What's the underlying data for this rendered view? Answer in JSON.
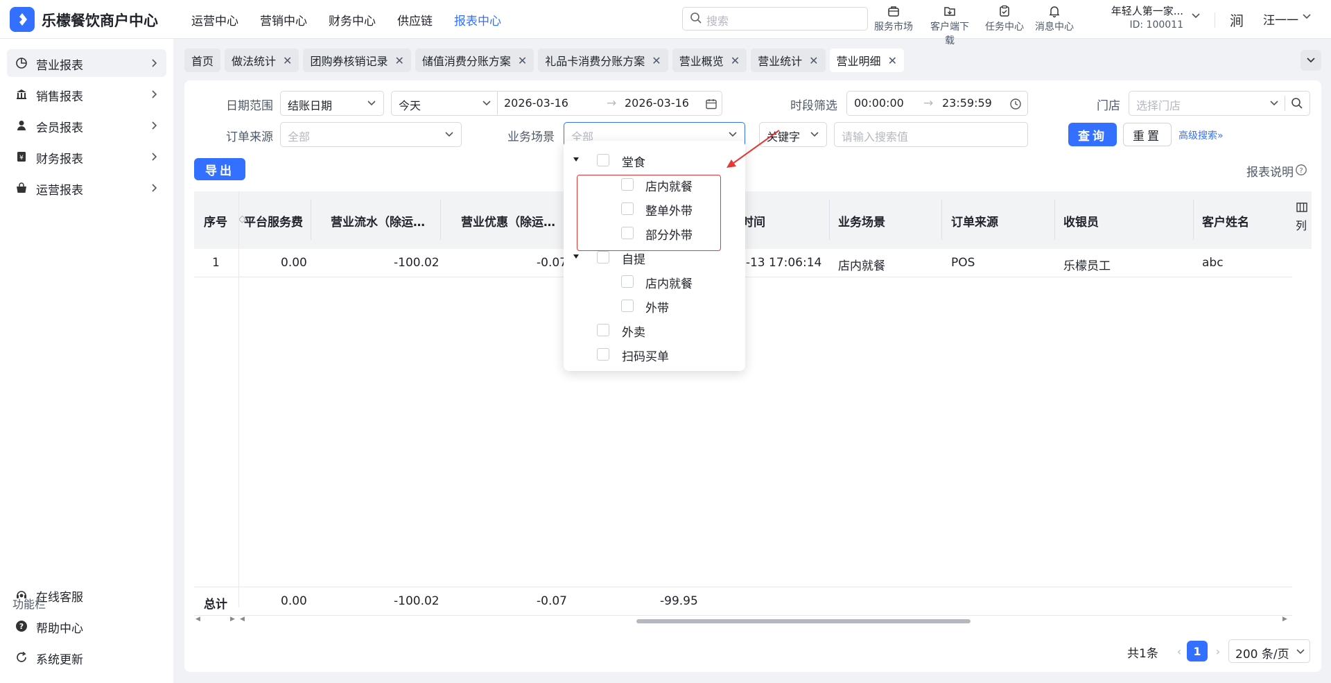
{
  "app": {
    "brand": "乐檬餐饮商户中心",
    "nav": [
      "运营中心",
      "营销中心",
      "财务中心",
      "供应链",
      "报表中心"
    ],
    "active_nav": "报表中心",
    "search_placeholder": "搜索",
    "tools": [
      {
        "label": "服务市场",
        "icon": "bag-icon"
      },
      {
        "label": "客户端下载",
        "icon": "download-folder-icon"
      },
      {
        "label": "任务中心",
        "icon": "clipboard-icon"
      },
      {
        "label": "消息中心",
        "icon": "bell-icon"
      }
    ],
    "account_name": "年轻人第一家...",
    "account_id": "ID: 100011",
    "avatar_glyph": "涧",
    "username": "汪一一"
  },
  "sidebar": {
    "items": [
      {
        "label": "营业报表",
        "icon": "analytics-icon"
      },
      {
        "label": "销售报表",
        "icon": "bank-icon"
      },
      {
        "label": "会员报表",
        "icon": "user-icon"
      },
      {
        "label": "财务报表",
        "icon": "ledger-icon"
      },
      {
        "label": "运营报表",
        "icon": "bag-icon"
      }
    ],
    "section_title": "功能栏",
    "bottom": [
      {
        "label": "在线客服",
        "icon": "headset-icon"
      },
      {
        "label": "帮助中心",
        "icon": "help-icon"
      },
      {
        "label": "系统更新",
        "icon": "refresh-icon"
      }
    ]
  },
  "tabs": [
    {
      "label": "首页",
      "closable": false
    },
    {
      "label": "做法统计",
      "closable": true
    },
    {
      "label": "团购券核销记录",
      "closable": true
    },
    {
      "label": "储值消费分账方案",
      "closable": true
    },
    {
      "label": "礼品卡消费分账方案",
      "closable": true
    },
    {
      "label": "营业概览",
      "closable": true
    },
    {
      "label": "营业统计",
      "closable": true
    },
    {
      "label": "营业明细",
      "closable": true,
      "active": true
    }
  ],
  "filters": {
    "date_range_label": "日期范围",
    "date_type": "结账日期",
    "date_preset": "今天",
    "date_start": "2026-03-16",
    "date_end": "2026-03-16",
    "time_label": "时段筛选",
    "time_start": "00:00:00",
    "time_end": "23:59:59",
    "store_label": "门店",
    "store_placeholder": "选择门店",
    "source_label": "订单来源",
    "source_value": "全部",
    "scene_label": "业务场景",
    "scene_value": "全部",
    "keyword_type": "关键字",
    "keyword_placeholder": "请输入搜索值",
    "query_btn": "查询",
    "reset_btn": "重置",
    "advanced": "高级搜索",
    "export_btn": "导出",
    "report_desc": "报表说明"
  },
  "table": {
    "columns": [
      "序号",
      "平台服务费",
      "营业流水（除运…",
      "营业优惠（除运…",
      "时间",
      "业务场景",
      "订单来源",
      "收银员",
      "客户姓名"
    ],
    "column_settings": "列",
    "rows": [
      {
        "no": "1",
        "service_fee": "0.00",
        "revenue": "-100.02",
        "discount": "-0.07",
        "time": "3-13 17:06:14",
        "scene": "店内就餐",
        "source": "POS",
        "cashier": "乐檬员工",
        "customer": "abc"
      }
    ],
    "footer": {
      "label": "总计",
      "service_fee": "0.00",
      "revenue": "-100.02",
      "discount": "-0.07",
      "net": "-99.95"
    }
  },
  "pagination": {
    "total": "共1条",
    "current": "1",
    "page_size": "200 条/页"
  },
  "scene_dropdown": {
    "groups": [
      {
        "label": "堂食",
        "children": [
          "店内就餐",
          "整单外带",
          "部分外带"
        ]
      },
      {
        "label": "自提",
        "children": [
          "店内就餐",
          "外带"
        ]
      },
      {
        "label": "外卖",
        "children": []
      },
      {
        "label": "扫码买单",
        "children": []
      }
    ]
  },
  "colors": {
    "accent": "#3370ff",
    "annotation": "#e53935"
  }
}
